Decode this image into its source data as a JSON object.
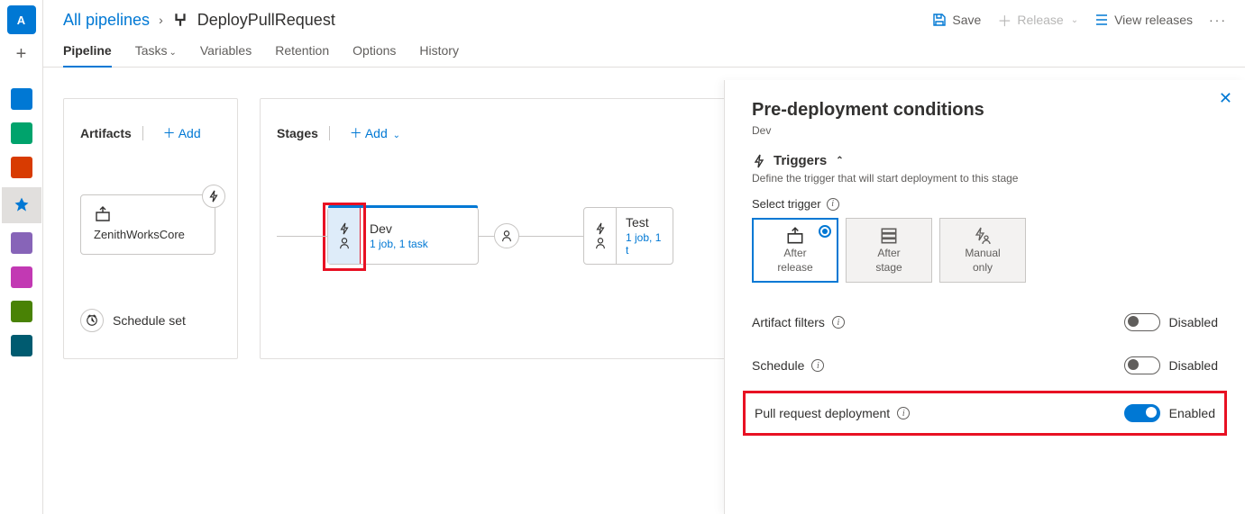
{
  "leftbar": {
    "badge": "A"
  },
  "breadcrumbs": {
    "all": "All pipelines",
    "name": "DeployPullRequest"
  },
  "top_actions": {
    "save": "Save",
    "release": "Release",
    "view_releases": "View releases"
  },
  "tabs": [
    "Pipeline",
    "Tasks",
    "Variables",
    "Retention",
    "Options",
    "History"
  ],
  "active_tab": 0,
  "artifacts": {
    "title": "Artifacts",
    "add": "Add",
    "items": [
      {
        "name": "ZenithWorksCore"
      }
    ],
    "schedule_label": "Schedule set"
  },
  "stages": {
    "title": "Stages",
    "add": "Add",
    "items": [
      {
        "name": "Dev",
        "jobs": "1 job, 1 task"
      },
      {
        "name": "Test",
        "jobs": "1 job, 1 t"
      }
    ]
  },
  "panel": {
    "title": "Pre-deployment conditions",
    "stage": "Dev",
    "triggers": {
      "title": "Triggers",
      "desc": "Define the trigger that will start deployment to this stage",
      "select_label": "Select trigger",
      "options": [
        {
          "line1": "After",
          "line2": "release"
        },
        {
          "line1": "After",
          "line2": "stage"
        },
        {
          "line1": "Manual",
          "line2": "only"
        }
      ],
      "selected": 0
    },
    "filters": {
      "label": "Artifact filters",
      "state": "Disabled"
    },
    "schedule": {
      "label": "Schedule",
      "state": "Disabled"
    },
    "pr": {
      "label": "Pull request deployment",
      "state": "Enabled"
    }
  }
}
